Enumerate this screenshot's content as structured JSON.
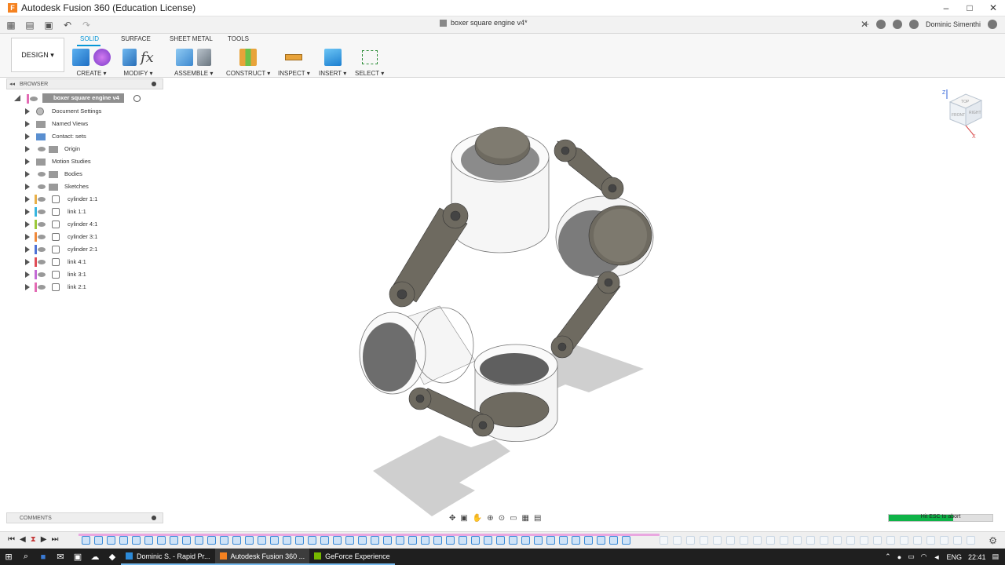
{
  "window": {
    "title": "Autodesk Fusion 360 (Education License)",
    "controls": [
      "–",
      "□",
      "✕"
    ]
  },
  "doc_tab": {
    "title": "boxer square engine v4*"
  },
  "user": {
    "name": "Dominic Simenthi"
  },
  "workspace": {
    "label": "DESIGN ▾"
  },
  "ribbon_tabs": [
    "SOLID",
    "SURFACE",
    "SHEET METAL",
    "TOOLS"
  ],
  "ribbon_groups": [
    "CREATE ▾",
    "MODIFY ▾",
    "ASSEMBLE ▾",
    "CONSTRUCT ▾",
    "INSPECT ▾",
    "INSERT ▾",
    "SELECT ▾"
  ],
  "browser": {
    "title": "BROWSER",
    "root": "boxer square engine v4",
    "items": [
      {
        "label": "Document Settings",
        "icon": "gear-icon",
        "color": ""
      },
      {
        "label": "Named Views",
        "icon": "folder-icon",
        "color": ""
      },
      {
        "label": "Contact: sets",
        "icon": "contact-icon",
        "color": ""
      },
      {
        "label": "Origin",
        "icon": "folder-icon",
        "color": ""
      },
      {
        "label": "Motion Studies",
        "icon": "folder-icon",
        "color": ""
      },
      {
        "label": "Bodies",
        "icon": "folder-icon",
        "color": ""
      },
      {
        "label": "Sketches",
        "icon": "folder-icon",
        "color": ""
      },
      {
        "label": "cylinder 1:1",
        "icon": "component-icon",
        "color": "#e8b04a"
      },
      {
        "label": "link 1:1",
        "icon": "component-icon",
        "color": "#38b6e0"
      },
      {
        "label": "cylinder 4:1",
        "icon": "component-icon",
        "color": "#9cc93b"
      },
      {
        "label": "cylinder 3:1",
        "icon": "component-icon",
        "color": "#f08a3c"
      },
      {
        "label": "cylinder 2:1",
        "icon": "component-icon",
        "color": "#4f73d6"
      },
      {
        "label": "link 4:1",
        "icon": "component-icon",
        "color": "#e04d57"
      },
      {
        "label": "link 3:1",
        "icon": "component-icon",
        "color": "#c46bd6"
      },
      {
        "label": "link 2:1",
        "icon": "component-icon",
        "color": "#e36bb4"
      }
    ]
  },
  "comments": {
    "title": "COMMENTS"
  },
  "progress": {
    "text": "Hit ESC to abort",
    "fill_fraction": 0.62,
    "color": "#0eb347"
  },
  "taskbar": {
    "apps": [
      {
        "label": "Dominic S. - Rapid Pr...",
        "icon": "edge-icon",
        "active": false
      },
      {
        "label": "Autodesk Fusion 360 ...",
        "icon": "fusion-icon",
        "active": true
      },
      {
        "label": "GeForce Experience",
        "icon": "geforce-icon",
        "active": false
      }
    ],
    "lang": "ENG",
    "time": "22:41"
  },
  "viewcube": {
    "faces": [
      "TOP",
      "FRONT",
      "RIGHT"
    ],
    "axes": [
      "Z",
      "X"
    ]
  }
}
